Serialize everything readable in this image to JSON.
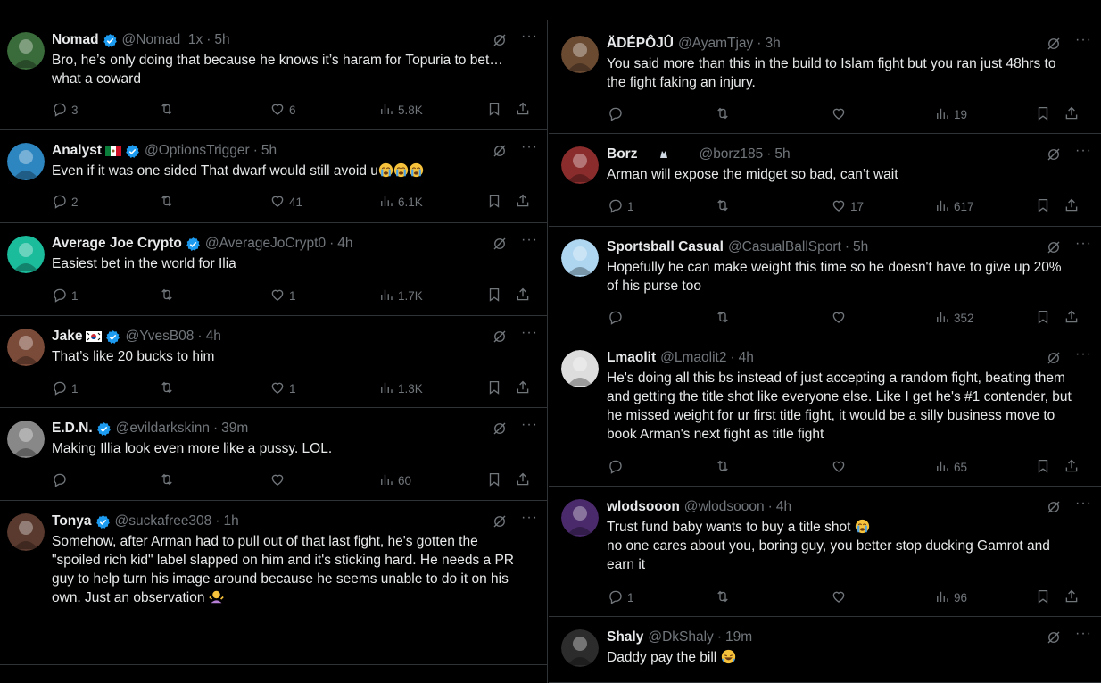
{
  "left_posts": [
    {
      "name": "Nomad",
      "flag": "",
      "verified": true,
      "handle": "@Nomad_1x",
      "time": "5h",
      "lines": [
        "Bro, he’s only doing that because he knows it’s haram for Topuria to bet…",
        "what a coward"
      ],
      "emoji": "",
      "replies": "3",
      "likes": "6",
      "views": "5.8K",
      "avatar_color": "#3a6b3a"
    },
    {
      "name": "Analyst",
      "flag": "mexico",
      "verified": true,
      "handle": "@OptionsTrigger",
      "time": "5h",
      "lines": [
        "Even if it was one sided That dwarf would still avoid u"
      ],
      "emoji": "crying x3",
      "replies": "2",
      "likes": "41",
      "views": "6.1K",
      "avatar_color": "#2e86c1"
    },
    {
      "name": "Average Joe Crypto",
      "flag": "",
      "verified": true,
      "handle": "@AverageJoCrypt0",
      "time": "4h",
      "lines": [
        "Easiest bet in the world for Ilia"
      ],
      "emoji": "",
      "replies": "1",
      "likes": "1",
      "views": "1.7K",
      "avatar_color": "#1abc9c"
    },
    {
      "name": "Jake",
      "flag": "korea",
      "verified": true,
      "handle": "@YvesB08",
      "time": "4h",
      "lines": [
        "That’s like 20 bucks to him"
      ],
      "emoji": "",
      "replies": "1",
      "likes": "1",
      "views": "1.3K",
      "avatar_color": "#7b4b3a"
    },
    {
      "name": "E.D.N.",
      "flag": "",
      "verified": true,
      "handle": "@evildarkskinn",
      "time": "39m",
      "lines": [
        "Making Illia look even more like a pussy. LOL."
      ],
      "emoji": "",
      "replies": "",
      "likes": "",
      "views": "60",
      "avatar_color": "#888888"
    },
    {
      "name": "Tonya",
      "flag": "",
      "verified": true,
      "handle": "@suckafree308",
      "time": "1h",
      "lines": [
        "Somehow, after Arman had to pull out of that last fight, he's gotten the",
        "\"spoiled rich kid\" label slapped on him and it's sticking hard.  He needs a PR",
        "guy to help turn his image around because he seems unable to do it on his",
        "own.  Just an observation"
      ],
      "emoji": "shrug",
      "replies": "",
      "likes": "",
      "views": "",
      "avatar_color": "#5a3a2e"
    }
  ],
  "right_posts": [
    {
      "name": "ÄDÉPÔJÛ",
      "flag": "",
      "verified": false,
      "handle": "@AyamTjay",
      "time": "3h",
      "lines": [
        "You said more than this in the build to Islam fight but you ran just 48hrs to",
        "the fight faking an injury."
      ],
      "emoji": "",
      "replies": "",
      "likes": "",
      "views": "19",
      "avatar_color": "#6b4a32"
    },
    {
      "name": "Borz",
      "flag": "wolves",
      "verified": false,
      "handle": "@borz185",
      "time": "5h",
      "lines": [
        "Arman will expose the midget so bad, can’t wait"
      ],
      "emoji": "",
      "replies": "1",
      "likes": "17",
      "views": "617",
      "avatar_color": "#8b2c2c"
    },
    {
      "name": "Sportsball Casual",
      "flag": "",
      "verified": false,
      "handle": "@CasualBallSport",
      "time": "5h",
      "lines": [
        "Hopefully he can make weight this time so he doesn't have to give up 20%",
        "of his purse too"
      ],
      "emoji": "",
      "replies": "",
      "likes": "",
      "views": "352",
      "avatar_color": "#aed6f1"
    },
    {
      "name": "Lmaolit",
      "flag": "",
      "verified": false,
      "handle": "@Lmaolit2",
      "time": "4h",
      "lines": [
        "He's doing all this bs instead of just accepting a random fight, beating them",
        "and getting the title shot like everyone else. Like I get he's #1 contender, but",
        "he missed weight for ur first title fight, it would be a silly business move to",
        "book Arman's next fight as title fight"
      ],
      "emoji": "",
      "replies": "",
      "likes": "",
      "views": "65",
      "avatar_color": "#dddddd"
    },
    {
      "name": "wlodsooon",
      "flag": "",
      "verified": false,
      "handle": "@wlodsooon",
      "time": "4h",
      "lines": [
        "Trust fund baby wants to buy a title shot",
        "no one cares about you, boring guy, you better stop ducking Gamrot and",
        "earn it"
      ],
      "emoji": "crying",
      "replies": "1",
      "likes": "",
      "views": "96",
      "avatar_color": "#4a2a6b"
    },
    {
      "name": "Shaly",
      "flag": "",
      "verified": false,
      "handle": "@DkShaly",
      "time": "19m",
      "lines": [
        "Daddy pay the bill"
      ],
      "emoji": "laughing",
      "replies": "",
      "likes": "",
      "views": "",
      "avatar_color": "#2c2c2c"
    }
  ],
  "colors": {
    "background": "#000000",
    "text": "#e7e9ea",
    "muted": "#71767b",
    "verified": "#1d9bf0",
    "divider": "#2f3336"
  },
  "icons": [
    "reply-icon",
    "retweet-icon",
    "like-icon",
    "views-icon",
    "bookmark-icon",
    "share-icon",
    "grok-icon",
    "more-icon",
    "verified-icon"
  ]
}
